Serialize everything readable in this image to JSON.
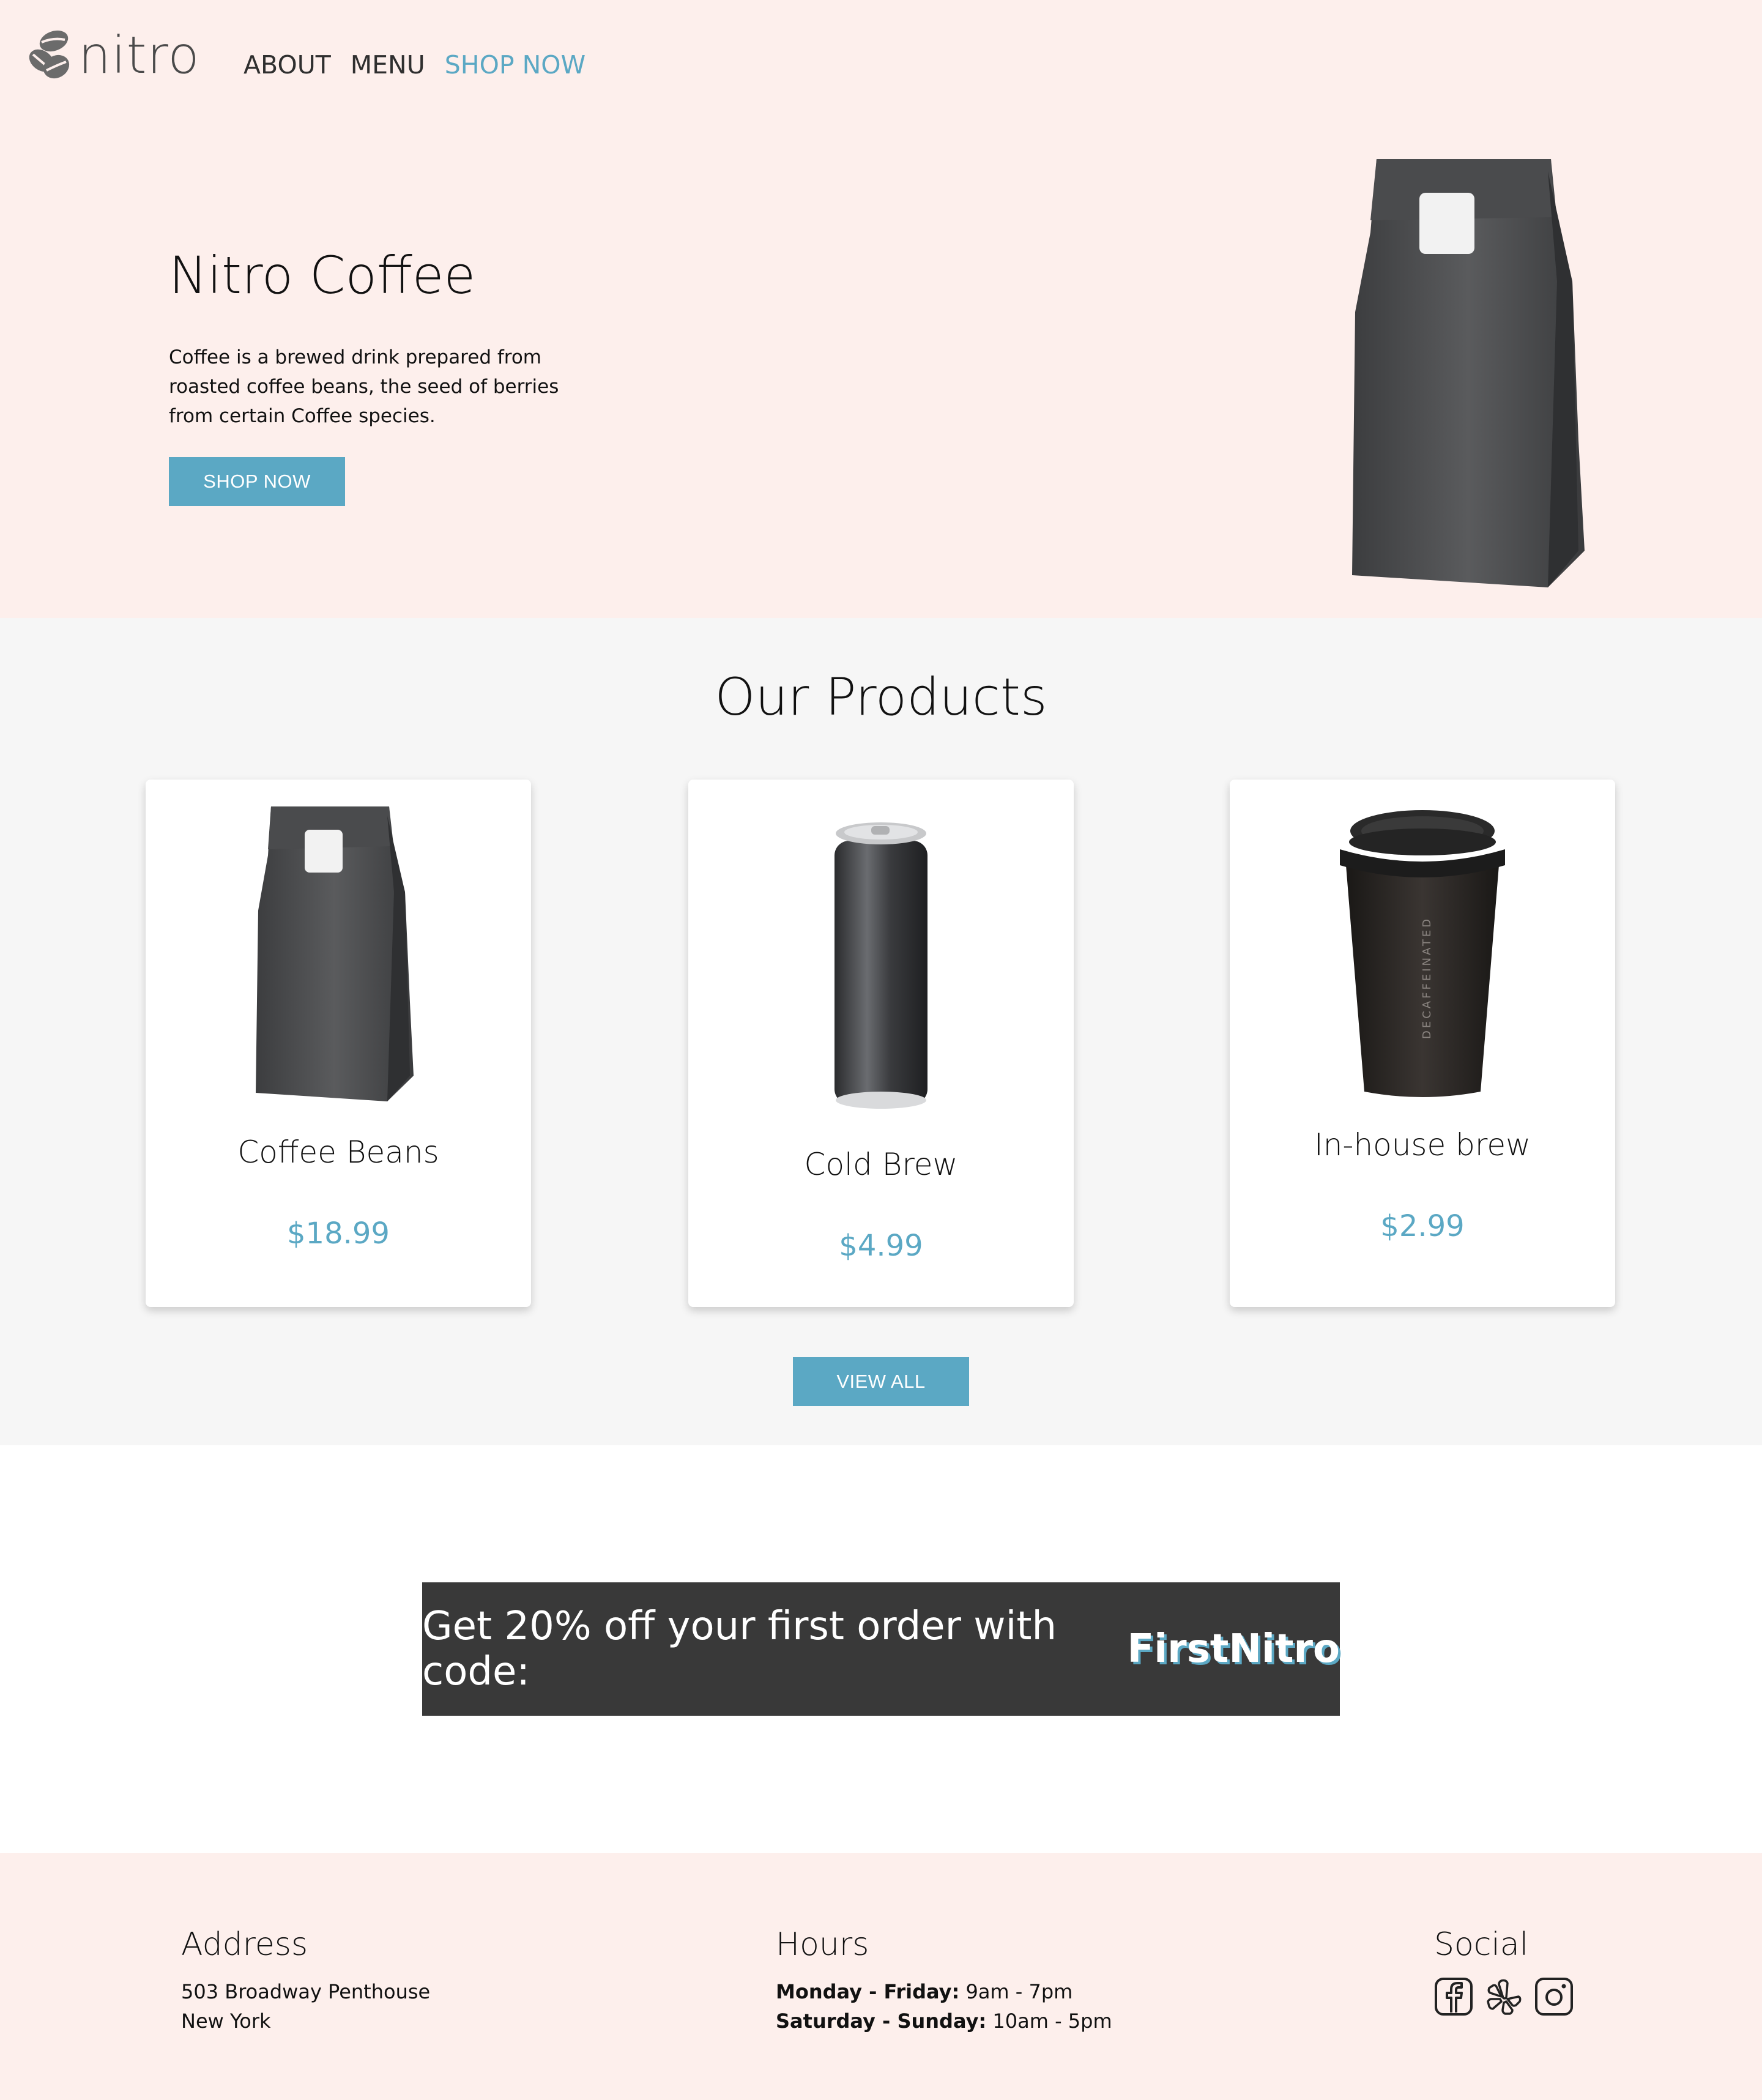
{
  "header": {
    "logo_text": "nitro",
    "nav": [
      {
        "label": "ABOUT"
      },
      {
        "label": "MENU"
      },
      {
        "label": "SHOP NOW"
      }
    ]
  },
  "hero": {
    "title": "Nitro Coffee",
    "description": "Coffee is a brewed drink prepared from roasted coffee beans, the seed of berries from certain Coffee species.",
    "button_label": "SHOP NOW"
  },
  "products": {
    "title": "Our Products",
    "items": [
      {
        "name": "Coffee Beans",
        "price": "$18.99",
        "image": "coffee-bag"
      },
      {
        "name": "Cold Brew",
        "price": "$4.99",
        "image": "can"
      },
      {
        "name": "In-house brew",
        "price": "$2.99",
        "image": "cup",
        "cup_text": "DECAFFEINATED"
      }
    ],
    "view_all_label": "VIEW ALL"
  },
  "promo": {
    "text": "Get 20% off your first order with code:",
    "code": "FirstNitro"
  },
  "footer": {
    "address": {
      "heading": "Address",
      "line1": "503 Broadway Penthouse",
      "line2": "New York"
    },
    "hours": {
      "heading": "Hours",
      "weekday_label": "Monday - Friday:",
      "weekday_hours": "9am - 7pm",
      "weekend_label": "Saturday - Sunday:",
      "weekend_hours": "10am - 5pm"
    },
    "social": {
      "heading": "Social",
      "icons": [
        "facebook-icon",
        "yelp-icon",
        "instagram-icon"
      ]
    }
  },
  "colors": {
    "accent": "#5ba8c4",
    "hero_bg": "#fdefec",
    "products_bg": "#f6f6f6",
    "promo_bg": "#393939"
  }
}
